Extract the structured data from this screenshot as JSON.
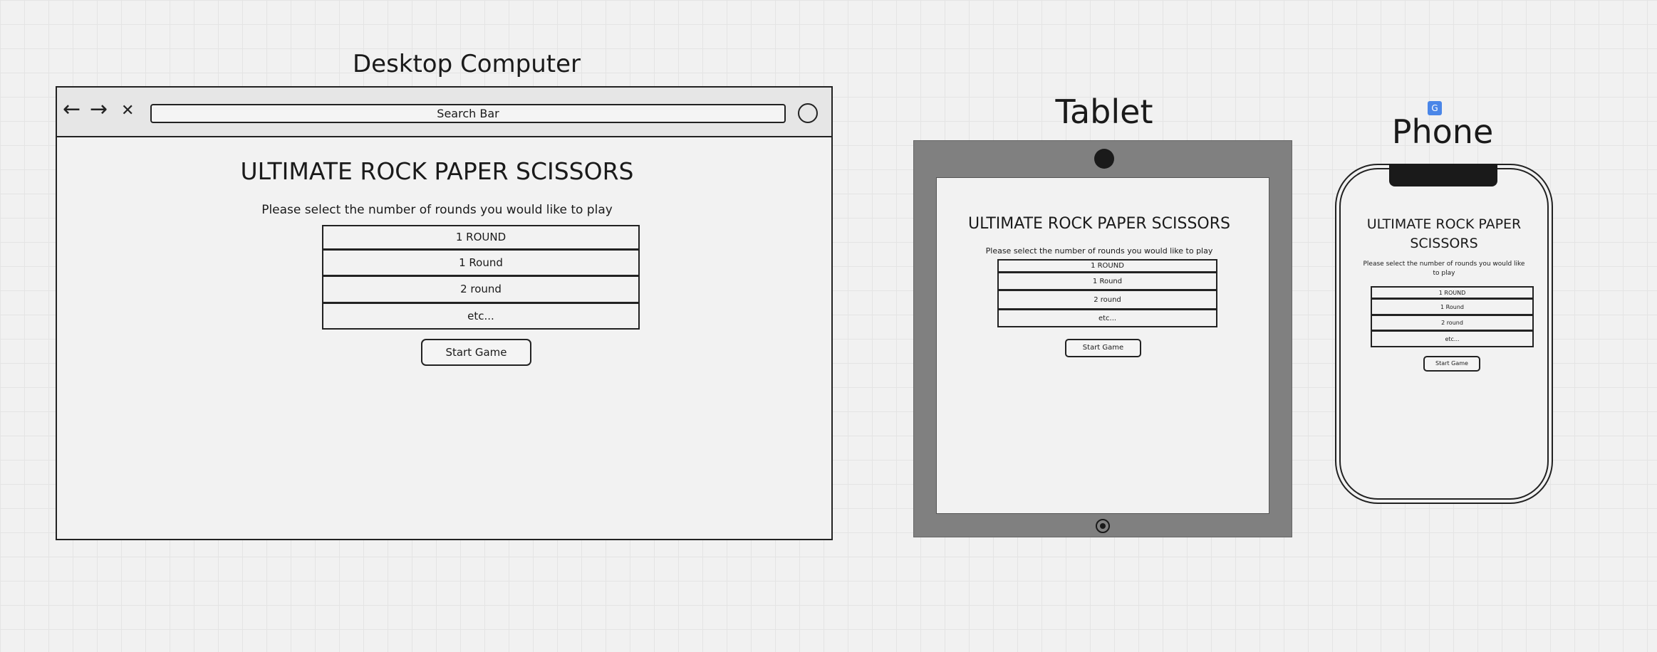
{
  "devices": {
    "desktop": {
      "label": "Desktop Computer",
      "browser": {
        "back_icon": "←",
        "forward_icon": "→",
        "close_icon": "✕",
        "search_label": "Search Bar"
      }
    },
    "tablet": {
      "label": "Tablet"
    },
    "phone": {
      "label": "Phone"
    }
  },
  "app": {
    "title": "ULTIMATE ROCK PAPER SCISSORS",
    "phone_title_line1": "ULTIMATE ROCK PAPER",
    "phone_title_line2": "SCISSORS",
    "prompt": "Please select the number of rounds you would like to play",
    "phone_prompt_line1": "Please select the number of rounds you would like",
    "phone_prompt_line2": "to play",
    "options": [
      "1 ROUND",
      "1 Round",
      "2 round",
      "etc..."
    ],
    "start_button": "Start Game"
  },
  "icons": {
    "translate": "G"
  }
}
